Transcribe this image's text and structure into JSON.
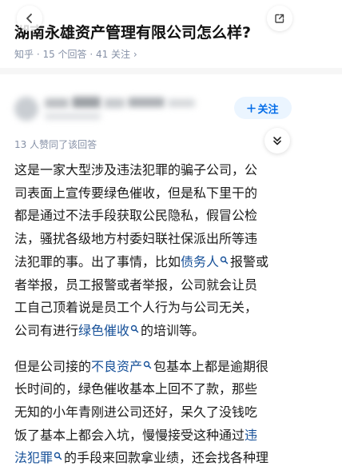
{
  "question": {
    "title": "湖南永雄资产管理有限公司怎么样?",
    "meta": "知乎 · 15 个回答 · 41 关注 ›"
  },
  "answer": {
    "follow_label": "关注",
    "likes": "13 人赞同了该回答",
    "p1": {
      "l1": "这是一家大型涉及违法犯罪的骗子公司，公",
      "l2": "司表面上宣传要绿色催收，但是私下里干的",
      "l3": "都是通过不法手段获取公民隐私，假冒公检",
      "l4": "法，骚扰各级地方村委妇联社保派出所等违",
      "l5a": "法犯罪的事。出了事情，比如",
      "l5kw": "债务人",
      "l5b": "报警或",
      "l6": "者举报，员工报警或者举报，公司就会让员",
      "l7": "工自己顶着说是员工个人行为与公司无关，",
      "l8a": "公司有进行",
      "l8kw": "绿色催收",
      "l8b": "的培训等。"
    },
    "p2": {
      "l1a": "但是公司接的",
      "l1kw": "不良资产",
      "l1b": "包基本上都是逾期很",
      "l2": "长时间的，绿色催收基本上回不了款，那些",
      "l3": "无知的小年青刚进公司还好，呆久了没钱吃",
      "l4a": "饭了基本上都会入坑，慢慢接受这种通过",
      "l4kw": "违",
      "l5kw": "法犯罪",
      "l5b": "的手段来回款拿业绩，还会找各种理"
    }
  },
  "colors": {
    "link": "#175199",
    "follow": "#056de8",
    "meta": "#8590a6"
  },
  "icons": [
    "back-arrow-icon",
    "share-icon",
    "plus-icon",
    "collapse-icon",
    "search-mark-icon"
  ]
}
